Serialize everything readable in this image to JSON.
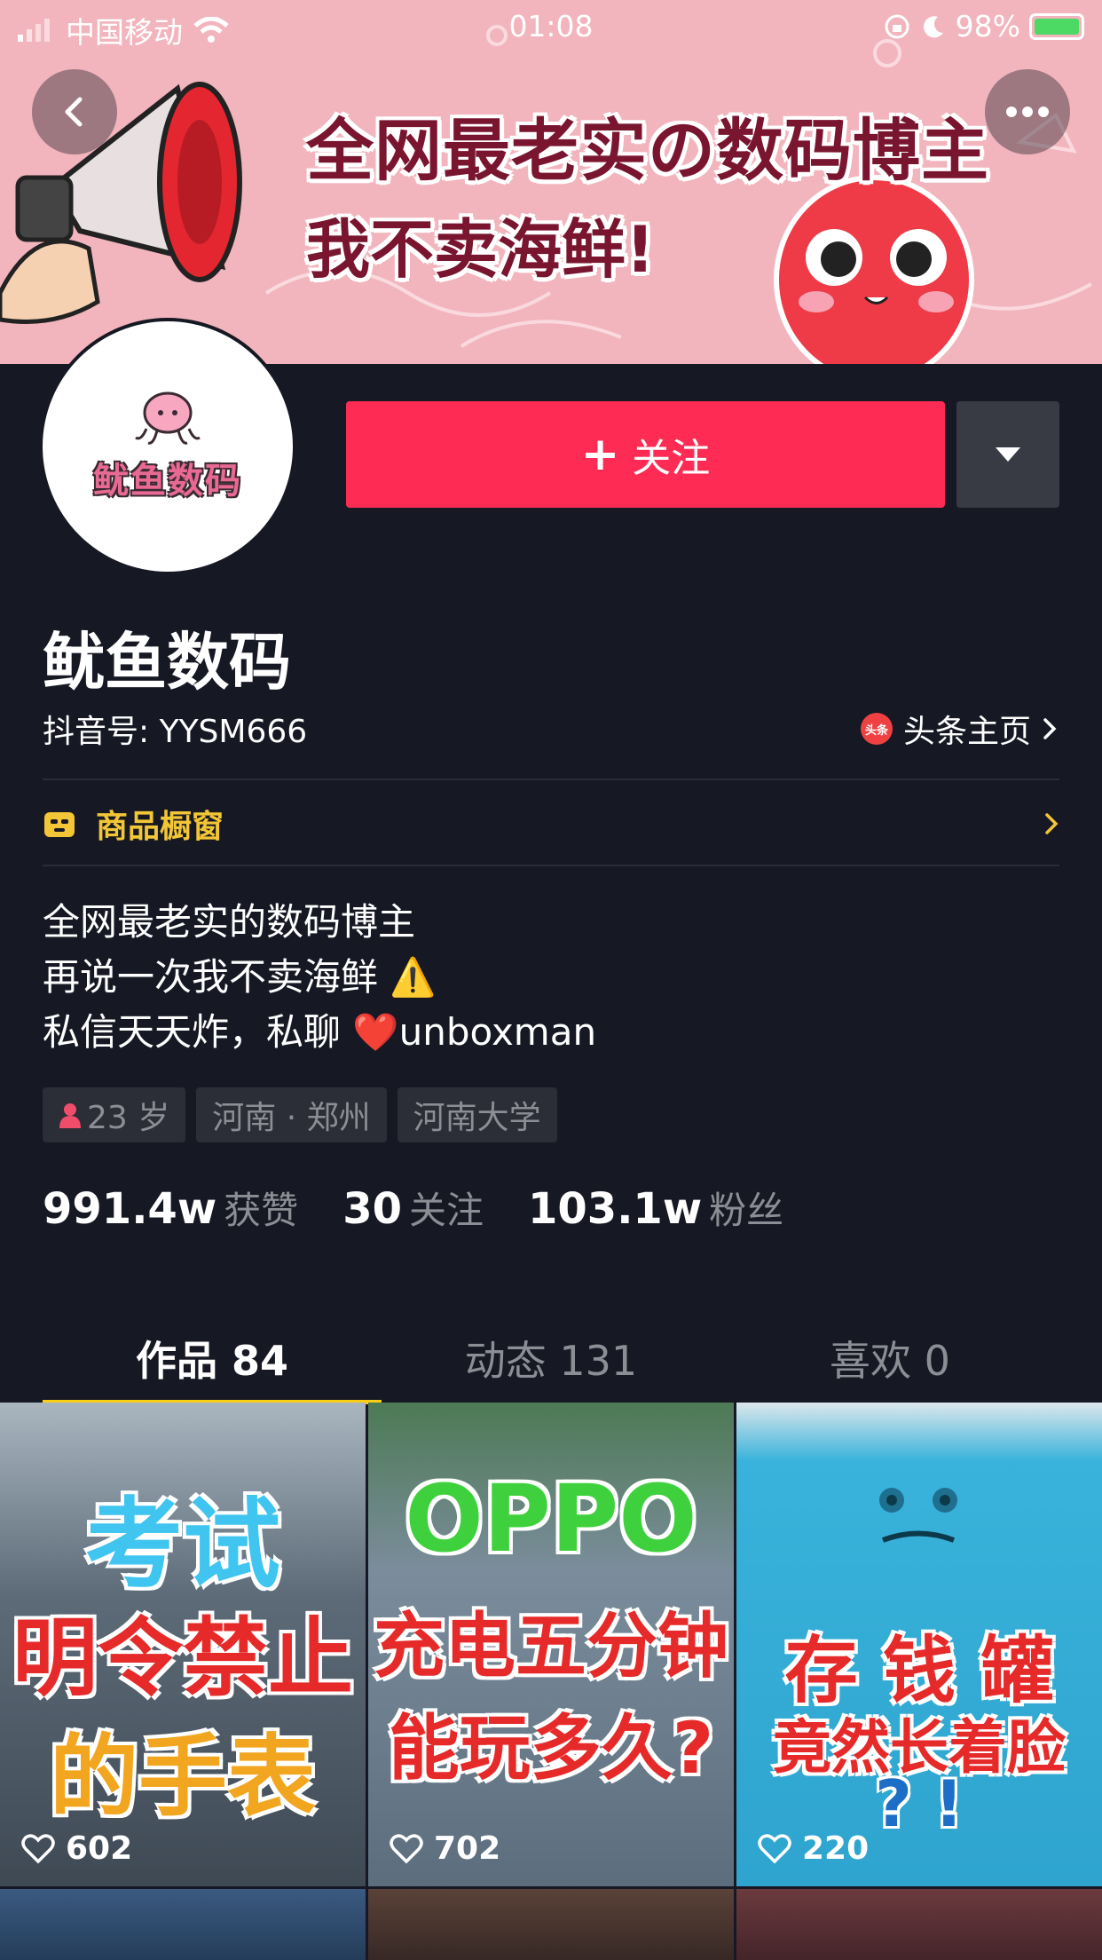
{
  "status_bar": {
    "carrier": "中国移动",
    "time": "01:08",
    "battery": "98%"
  },
  "banner": {
    "title": "全网最老实の数码博主",
    "subtitle": "我不卖海鲜!"
  },
  "profile": {
    "avatar_text": "鱿鱼数码",
    "nickname": "鱿鱼数码",
    "douyin_id": "抖音号: YYSM666",
    "toutiao_badge": "头条",
    "toutiao_link": "头条主页",
    "follow_label": "关注",
    "shop_label": "商品橱窗",
    "bio": [
      "全网最老实的数码博主",
      "再说一次我不卖海鲜 ⚠️",
      "私信天天炸，私聊 ❤️unboxman"
    ],
    "tags": [
      "23 岁",
      "河南 · 郑州",
      "河南大学"
    ],
    "stats": [
      {
        "num": "991.4w",
        "label": "获赞"
      },
      {
        "num": "30",
        "label": "关注"
      },
      {
        "num": "103.1w",
        "label": "粉丝"
      }
    ]
  },
  "tabs": [
    {
      "label": "作品 84",
      "active": true
    },
    {
      "label": "动态 131",
      "active": false
    },
    {
      "label": "喜欢 0",
      "active": false
    }
  ],
  "videos": [
    {
      "lines": [
        "考试",
        "明令禁止",
        "的手表"
      ],
      "likes": "602",
      "bg": "#5d6b78"
    },
    {
      "lines": [
        "OPPO",
        "充电五分钟",
        "能玩多久?"
      ],
      "likes": "702",
      "bg": "#6c7e8e"
    },
    {
      "lines": [
        "存 钱 罐",
        "竟然长着脸",
        "? !"
      ],
      "likes": "220",
      "bg": "#39b3db"
    }
  ],
  "colors": {
    "accent": "#fe2c55",
    "background": "#161823",
    "tab_indicator": "#face15",
    "shop": "#f2c636"
  }
}
